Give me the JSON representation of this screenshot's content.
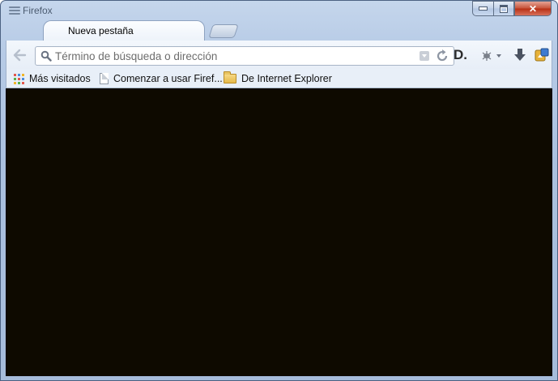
{
  "window": {
    "title": "Firefox",
    "controls": {
      "minimize": "minimize",
      "maximize": "maximize",
      "close": "✕"
    }
  },
  "tabs": [
    {
      "label": "Nueva pestaña",
      "active": true
    }
  ],
  "toolbar": {
    "url_placeholder": "Término de búsqueda o dirección",
    "url_value": "",
    "dictionary_label": "D."
  },
  "bookmarks": [
    {
      "label": "Más visitados",
      "icon": "grid-icon"
    },
    {
      "label": "Comenzar a usar Firef...",
      "icon": "page-icon"
    },
    {
      "label": "De Internet Explorer",
      "icon": "folder-icon"
    }
  ],
  "colors": {
    "content_background": "#0e0a00",
    "close_button": "#c7533b",
    "chrome_blue": "#b7cbe6"
  }
}
